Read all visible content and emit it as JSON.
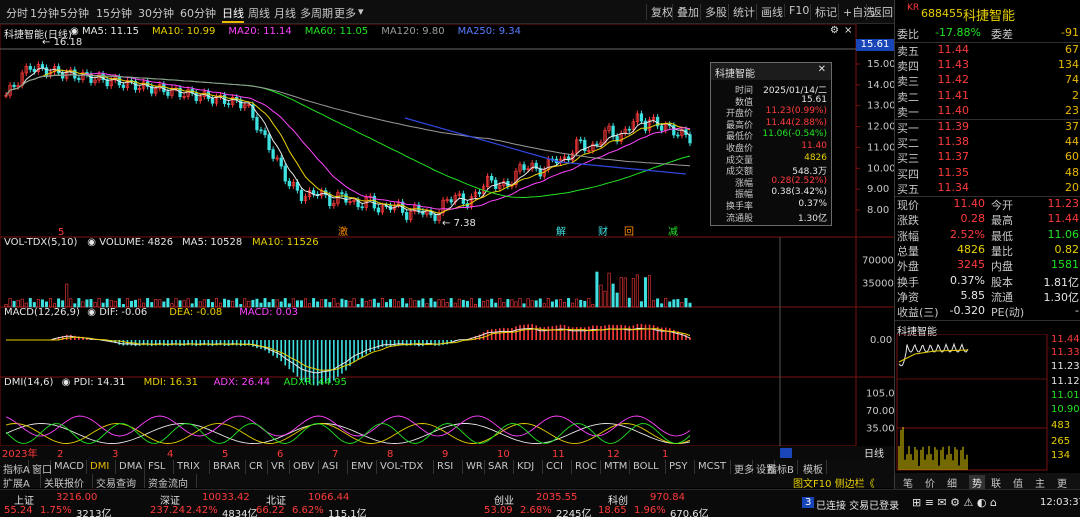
{
  "toolbar": {
    "periods": [
      "分时",
      "1分钟",
      "5分钟",
      "15分钟",
      "30分钟",
      "60分钟",
      "日线",
      "周线",
      "月线",
      "多周期",
      "更多"
    ],
    "buttons": [
      "复权",
      "叠加",
      "多股",
      "统计",
      "画线",
      "F10",
      "标记",
      "+自选",
      "返回"
    ]
  },
  "price_chart": {
    "title": "科捷智能(日线)",
    "ma": [
      {
        "label": "MA5: 11.15",
        "color": "#e6e6e6"
      },
      {
        "label": "MA10: 10.99",
        "color": "#e8d000"
      },
      {
        "label": "MA20: 11.14",
        "color": "#ff44ff"
      },
      {
        "label": "MA60: 11.05",
        "color": "#22e322"
      },
      {
        "label": "MA120: 9.80",
        "color": "#9a9a9a"
      },
      {
        "label": "MA250: 9.34",
        "color": "#5a7dff"
      }
    ],
    "y_ticks": [
      "15.00",
      "14.00",
      "13.00",
      "12.00",
      "11.00",
      "10.00",
      "9.00",
      "8.00"
    ],
    "current_price_box": "15.61",
    "high_mark": "16.18",
    "low_mark": "7.38",
    "events": [
      "5",
      "激",
      "解",
      "财",
      "回",
      "减"
    ]
  },
  "volume_panel": {
    "label": "VOL-TDX(5,10)",
    "values": [
      {
        "label": "VOLUME: 4826",
        "color": "#e6e6e6"
      },
      {
        "label": "MA5: 10528",
        "color": "#e6e6e6"
      },
      {
        "label": "MA10: 11526",
        "color": "#e8d000"
      }
    ],
    "y_ticks": [
      "70000",
      "35000"
    ]
  },
  "macd_panel": {
    "label": "MACD(12,26,9)",
    "values": [
      {
        "label": "DIF: -0.06",
        "color": "#e6e6e6"
      },
      {
        "label": "DEA: -0.08",
        "color": "#e8d000"
      },
      {
        "label": "MACD: 0.03",
        "color": "#ff44ff"
      }
    ],
    "y_ticks": [
      "0.00"
    ]
  },
  "dmi_panel": {
    "label": "DMI(14,6)",
    "values": [
      {
        "label": "PDI: 14.31",
        "color": "#e6e6e6"
      },
      {
        "label": "MDI: 16.31",
        "color": "#e8d000"
      },
      {
        "label": "ADX: 26.44",
        "color": "#ff44ff"
      },
      {
        "label": "ADXR: 44.95",
        "color": "#22e322"
      }
    ],
    "y_ticks": [
      "105.0",
      "70.00",
      "35.00"
    ]
  },
  "x_axis": {
    "labels": [
      "2023年",
      "2",
      "3",
      "4",
      "5",
      "6",
      "7",
      "8",
      "9",
      "10",
      "11",
      "12",
      "1"
    ],
    "period_label": "日线"
  },
  "tooltip": {
    "title": "科捷智能",
    "rows": [
      {
        "k": "时间",
        "v": "2025/01/14/二",
        "color": "#e6e6e6"
      },
      {
        "k": "数值",
        "v": "15.61",
        "color": "#e6e6e6"
      },
      {
        "k": "开盘价",
        "v": "11.23(0.99%)",
        "color": "#ff3b3b"
      },
      {
        "k": "最高价",
        "v": "11.44(2.88%)",
        "color": "#ff3b3b"
      },
      {
        "k": "最低价",
        "v": "11.06(-0.54%)",
        "color": "#22e322"
      },
      {
        "k": "收盘价",
        "v": "11.40",
        "color": "#ff3b3b"
      },
      {
        "k": "成交量",
        "v": "4826",
        "color": "#e8d000"
      },
      {
        "k": "成交额",
        "v": "548.3万",
        "color": "#e6e6e6"
      },
      {
        "k": "涨幅",
        "v": "0.28(2.52%)",
        "color": "#ff3b3b"
      },
      {
        "k": "振幅",
        "v": "0.38(3.42%)",
        "color": "#e6e6e6"
      },
      {
        "k": "换手率",
        "v": "0.37%",
        "color": "#e6e6e6"
      },
      {
        "k": "流通股",
        "v": "1.30亿",
        "color": "#e6e6e6"
      }
    ]
  },
  "indicator_tabs": [
    "指标A",
    "窗口",
    "MACD",
    "DMI",
    "DMA",
    "FSL",
    "TRIX",
    "BRAR",
    "CR",
    "VR",
    "OBV",
    "ASI",
    "EMV",
    "VOL-TDX",
    "RSI",
    "WR",
    "SAR",
    "KDJ",
    "CCI",
    "ROC",
    "MTM",
    "BOLL",
    "PSY",
    "MCST",
    "更多",
    "设置"
  ],
  "indicator_tabs_active": "DMI",
  "indicator_tabs_right": [
    "指标B",
    "模板"
  ],
  "sub_tabs": [
    "扩展A",
    "关联报价",
    "交易查询",
    "资金流向"
  ],
  "sub_tabs_right": "图文F10 侧边栏《",
  "right_panel": {
    "tag": "KR",
    "code": "688455",
    "name": "科捷智能",
    "weibi_label": "委比",
    "weibi": "-17.88%",
    "weicha_label": "委差",
    "weicha": "-91",
    "asks": [
      {
        "label": "卖五",
        "price": "11.44",
        "vol": "67"
      },
      {
        "label": "卖四",
        "price": "11.43",
        "vol": "134"
      },
      {
        "label": "卖三",
        "price": "11.42",
        "vol": "74"
      },
      {
        "label": "卖二",
        "price": "11.41",
        "vol": "2"
      },
      {
        "label": "卖一",
        "price": "11.40",
        "vol": "23"
      }
    ],
    "bids": [
      {
        "label": "买一",
        "price": "11.39",
        "vol": "37"
      },
      {
        "label": "买二",
        "price": "11.38",
        "vol": "44"
      },
      {
        "label": "买三",
        "price": "11.37",
        "vol": "60"
      },
      {
        "label": "买四",
        "price": "11.35",
        "vol": "48"
      },
      {
        "label": "买五",
        "price": "11.34",
        "vol": "20"
      }
    ],
    "quote": [
      {
        "a": "现价",
        "b": "11.40",
        "bc": "#ff3b3b",
        "d": "今开",
        "c": "11.23",
        "cc": "#ff3b3b"
      },
      {
        "a": "涨跌",
        "b": "0.28",
        "bc": "#ff3b3b",
        "d": "最高",
        "c": "11.44",
        "cc": "#ff3b3b"
      },
      {
        "a": "涨幅",
        "b": "2.52%",
        "bc": "#ff3b3b",
        "d": "最低",
        "c": "11.06",
        "cc": "#22e322"
      },
      {
        "a": "总量",
        "b": "4826",
        "bc": "#e8d000",
        "d": "量比",
        "c": "0.82",
        "cc": "#e8d000"
      },
      {
        "a": "外盘",
        "b": "3245",
        "bc": "#ff3b3b",
        "d": "内盘",
        "c": "1581",
        "cc": "#22e322"
      },
      {
        "a": "换手",
        "b": "0.37%",
        "bc": "#e6e6e6",
        "d": "股本",
        "c": "1.81亿",
        "cc": "#e6e6e6"
      },
      {
        "a": "净资",
        "b": "5.85",
        "bc": "#e6e6e6",
        "d": "流通",
        "c": "1.30亿",
        "cc": "#e6e6e6"
      },
      {
        "a": "收益(三)",
        "b": "-0.320",
        "bc": "#e6e6e6",
        "d": "PE(动)",
        "c": "-",
        "cc": "#e6e6e6"
      }
    ],
    "mini_title": "科捷智能",
    "mini_ticks": [
      "11.44",
      "11.33",
      "11.23",
      "11.12",
      "11.01",
      "10.90",
      "483",
      "265",
      "134"
    ],
    "bottom_tabs": [
      "笔",
      "价",
      "细",
      "势",
      "联",
      "值",
      "主",
      "更"
    ]
  },
  "status_bar": {
    "indices": [
      {
        "name": "上证",
        "value": "3216.00",
        "chg": "55.24",
        "pct": "1.75%",
        "amt": "3213亿"
      },
      {
        "name": "深证",
        "value": "10033.42",
        "chg": "237.24",
        "pct": "2.42%",
        "amt": "4834亿"
      },
      {
        "name": "北证",
        "value": "1066.44",
        "chg": "66.22",
        "pct": "6.62%",
        "amt": "115.1亿"
      },
      {
        "name": "创业",
        "value": "2035.55",
        "chg": "53.09",
        "pct": "2.68%",
        "amt": "2245亿"
      },
      {
        "name": "科创",
        "value": "970.84",
        "chg": "18.65",
        "pct": "1.96%",
        "amt": "670.6亿"
      }
    ],
    "connection": "已连接 交易已登录",
    "connection_badge": "3",
    "time": "12:03:37"
  }
}
